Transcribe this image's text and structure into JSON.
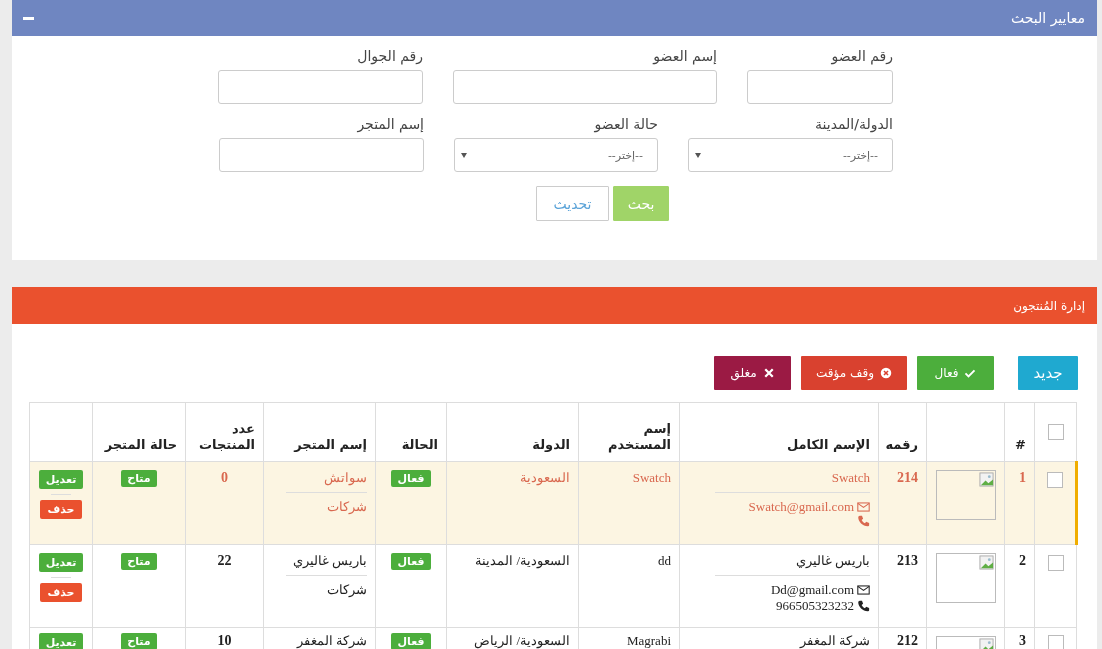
{
  "search_panel": {
    "title": "معايير البحث",
    "fields": [
      {
        "label": "رقم العضو",
        "kind": "text"
      },
      {
        "label": "إسم العضو",
        "kind": "text"
      },
      {
        "label": "رقم الجوال",
        "kind": "text"
      },
      {
        "label": "الدولة/المدينة",
        "kind": "select",
        "value": "--إختر--"
      },
      {
        "label": "حالة العضو",
        "kind": "select",
        "value": "--إختر--"
      },
      {
        "label": "إسم المتجر",
        "kind": "text"
      }
    ],
    "buttons": [
      {
        "label": "بحث",
        "kind": "primary"
      },
      {
        "label": "تحديث",
        "kind": "default"
      }
    ]
  },
  "management": {
    "title": "إدارة المُنتجون",
    "actions": [
      {
        "label": "جديد",
        "kind": "new"
      },
      {
        "label": "فعال",
        "kind": "active"
      },
      {
        "label": "وقف مؤقت",
        "kind": "suspend"
      },
      {
        "label": "مغلق",
        "kind": "closed"
      }
    ],
    "columns": [
      {
        "kind": "checkbox",
        "checked": false
      },
      {
        "kind": "index",
        "label": "#"
      },
      {
        "kind": "image"
      },
      {
        "kind": "number",
        "label": "رقمه"
      },
      {
        "kind": "name",
        "label": "الإسم الكامل"
      },
      {
        "kind": "username",
        "label": "إسم المستخدم"
      },
      {
        "kind": "country",
        "label": "الدولة"
      },
      {
        "kind": "status",
        "label": "الحالة"
      },
      {
        "kind": "store",
        "label": "إسم المتجر"
      },
      {
        "kind": "products",
        "label": "عدد المنتجات"
      },
      {
        "kind": "store_status",
        "label": "حالة المتجر"
      },
      {
        "kind": "actions"
      }
    ],
    "rows": [
      {
        "selected": true,
        "checked": false,
        "index": "1",
        "number": "214",
        "name": "Swatch",
        "email": "Swatch@gmail.com",
        "username": "Swatch",
        "country": "السعودية",
        "status": "فعال",
        "store_name": "سواتش",
        "store_type": "شركات",
        "products": "0",
        "store_status": "متاح",
        "edit": "تعديل",
        "delete": "حذف"
      },
      {
        "selected": false,
        "checked": false,
        "index": "2",
        "number": "213",
        "name": "باريس غاليري",
        "email": "Dd@gmail.com",
        "phone": "966505323232",
        "username": "dd",
        "country": "السعودية/ المدينة",
        "status": "فعال",
        "store_name": "باريس غاليري",
        "store_type": "شركات",
        "products": "22",
        "store_status": "متاح",
        "edit": "تعديل",
        "delete": "حذف"
      },
      {
        "selected": false,
        "checked": false,
        "index": "3",
        "number": "212",
        "name": "شركة المغفر",
        "username": "Magrabi",
        "country": "السعودية/ الرياض",
        "status": "فعال",
        "store_name": "شركة المغفر",
        "products": "10",
        "store_status": "متاح",
        "edit": "تعديل"
      }
    ]
  }
}
